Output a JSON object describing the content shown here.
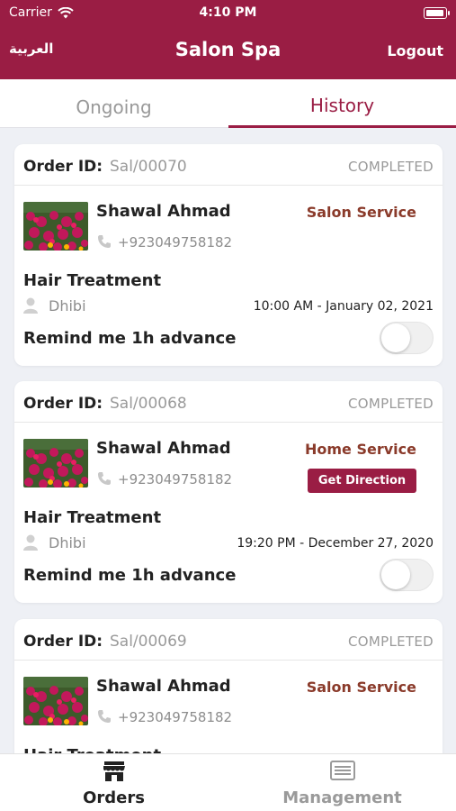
{
  "status_bar": {
    "carrier": "Carrier",
    "time": "4:10 PM",
    "battery_level": 1.0
  },
  "header": {
    "language_label": "العربية",
    "title": "Salon Spa",
    "logout_label": "Logout",
    "color": "#9a1d44"
  },
  "tabs": [
    {
      "label": "Ongoing",
      "active": false
    },
    {
      "label": "History",
      "active": true
    }
  ],
  "orders": [
    {
      "order_label": "Order ID:",
      "order_id": "Sal/00070",
      "status": "COMPLETED",
      "customer": "Shawal Ahmad",
      "phone": "+923049758182",
      "service_type": "Salon Service",
      "treatment": "Hair Treatment",
      "stylist": "Dhibi",
      "datetime": "10:00 AM - January 02, 2021",
      "remind_label": "Remind me 1h advance",
      "remind_enabled": false
    },
    {
      "order_label": "Order ID:",
      "order_id": "Sal/00068",
      "status": "COMPLETED",
      "customer": "Shawal Ahmad",
      "phone": "+923049758182",
      "service_type": "Home Service",
      "direction_label": "Get Direction",
      "treatment": "Hair Treatment",
      "stylist": "Dhibi",
      "datetime": "19:20 PM - December 27, 2020",
      "remind_label": "Remind me 1h advance",
      "remind_enabled": false
    },
    {
      "order_label": "Order ID:",
      "order_id": "Sal/00069",
      "status": "COMPLETED",
      "customer": "Shawal Ahmad",
      "phone": "+923049758182",
      "service_type": "Salon Service",
      "treatment": "Hair Treatment"
    }
  ],
  "bottom_nav": [
    {
      "label": "Orders",
      "icon": "store-icon",
      "active": true
    },
    {
      "label": "Management",
      "icon": "list-icon",
      "active": false
    }
  ]
}
